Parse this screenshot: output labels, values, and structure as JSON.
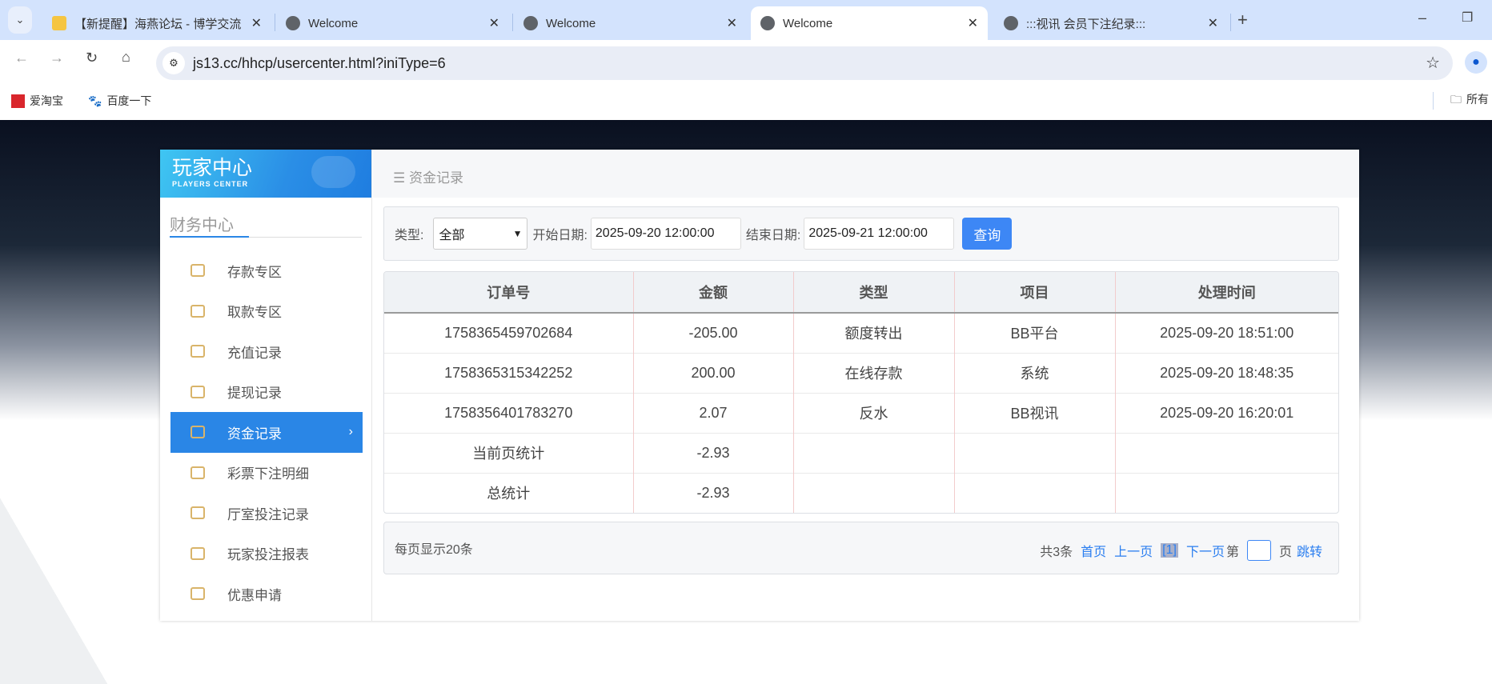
{
  "browser": {
    "tabs": [
      {
        "title": "【新提醒】海燕论坛 - 博学交流",
        "icon": "forum-favicon"
      },
      {
        "title": "Welcome",
        "icon": "globe-icon"
      },
      {
        "title": "Welcome",
        "icon": "globe-icon"
      },
      {
        "title": "Welcome",
        "icon": "globe-icon",
        "active": true
      },
      {
        "title": ":::视讯 会员下注纪录:::",
        "icon": "globe-icon"
      }
    ],
    "url": "js13.cc/hhcp/usercenter.html?iniType=6",
    "bookmarks": [
      {
        "label": "爱淘宝"
      },
      {
        "label": "百度一下"
      }
    ],
    "bookmarks_folder": "所有"
  },
  "sidebar": {
    "logo_cn": "玩家中心",
    "logo_en": "PLAYERS CENTER",
    "section": "财务中心",
    "items": [
      {
        "label": "存款专区"
      },
      {
        "label": "取款专区"
      },
      {
        "label": "充值记录"
      },
      {
        "label": "提现记录"
      },
      {
        "label": "资金记录",
        "active": true
      },
      {
        "label": "彩票下注明细"
      },
      {
        "label": "厅室投注记录"
      },
      {
        "label": "玩家投注报表"
      },
      {
        "label": "优惠申请"
      }
    ]
  },
  "main": {
    "title": "资金记录",
    "filter": {
      "type_label": "类型:",
      "type_value": "全部",
      "start_label": "开始日期:",
      "start_value": "2025-09-20 12:00:00",
      "end_label": "结束日期:",
      "end_value": "2025-09-21 12:00:00",
      "query": "查询"
    },
    "table": {
      "headers": [
        "订单号",
        "金额",
        "类型",
        "项目",
        "处理时间"
      ],
      "rows": [
        [
          "1758365459702684",
          "-205.00",
          "额度转出",
          "BB平台",
          "2025-09-20 18:51:00"
        ],
        [
          "1758365315342252",
          "200.00",
          "在线存款",
          "系统",
          "2025-09-20 18:48:35"
        ],
        [
          "1758356401783270",
          "2.07",
          "反水",
          "BB视讯",
          "2025-09-20 16:20:01"
        ],
        [
          "当前页统计",
          "-2.93",
          "",
          "",
          ""
        ],
        [
          "总统计",
          "-2.93",
          "",
          "",
          ""
        ]
      ]
    },
    "pager": {
      "per_page": "每页显示20条",
      "total": "共3条",
      "first": "首页",
      "prev": "上一页",
      "current": "[1]",
      "next": "下一页",
      "page_prefix": "第",
      "page_suffix": "页",
      "jump": "跳转"
    }
  },
  "colors": {
    "accent": "#2a86e6",
    "button": "#3d87f5"
  }
}
